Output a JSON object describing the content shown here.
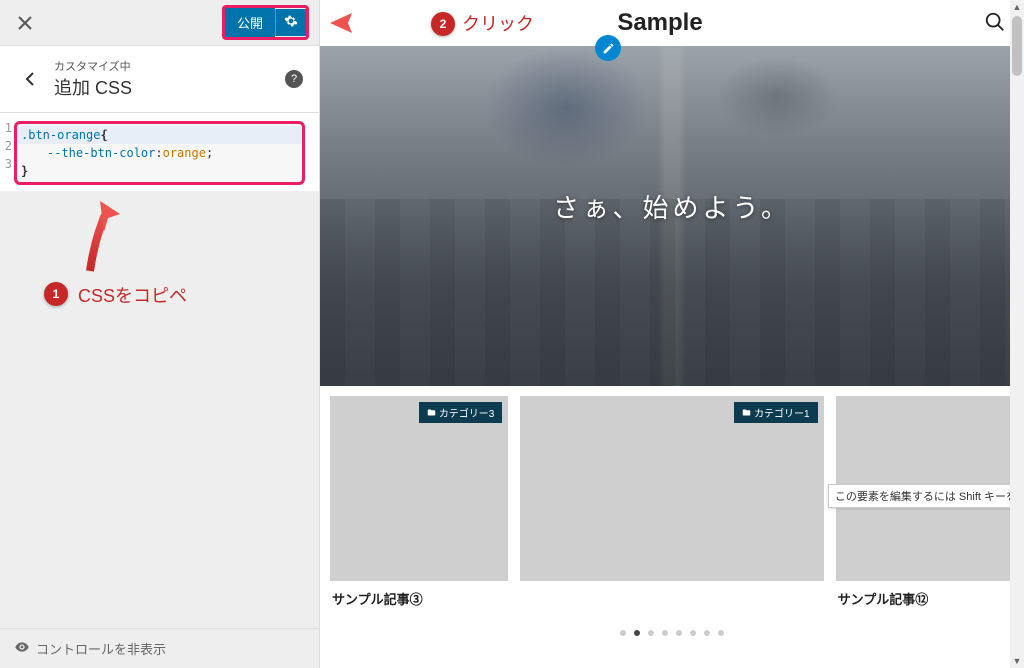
{
  "sidebar": {
    "publish_label": "公開",
    "header_sub": "カスタマイズ中",
    "header_title": "追加 CSS",
    "footer_label": "コントロールを非表示"
  },
  "code": {
    "line1_selector": ".btn-orange",
    "line1_brace": "{",
    "line2_prop": "--the-btn-color",
    "line2_colon": ":",
    "line2_value": " orange",
    "line2_semi": ";",
    "line3_brace": "}"
  },
  "annotations": {
    "badge1": "1",
    "text1": "CSSをコピペ",
    "badge2": "2",
    "text2": "クリック"
  },
  "preview": {
    "site_title": "Sample",
    "hero_text": "さぁ、始めよう。",
    "cards": [
      {
        "tag": "カテゴリー3",
        "title": "サンプル記事③"
      },
      {
        "tag": "カテゴリー1",
        "title": ""
      },
      {
        "tag": "",
        "title": "サンプル記事⑫"
      }
    ],
    "tooltip": "この要素を編集するには Shift キーを"
  }
}
